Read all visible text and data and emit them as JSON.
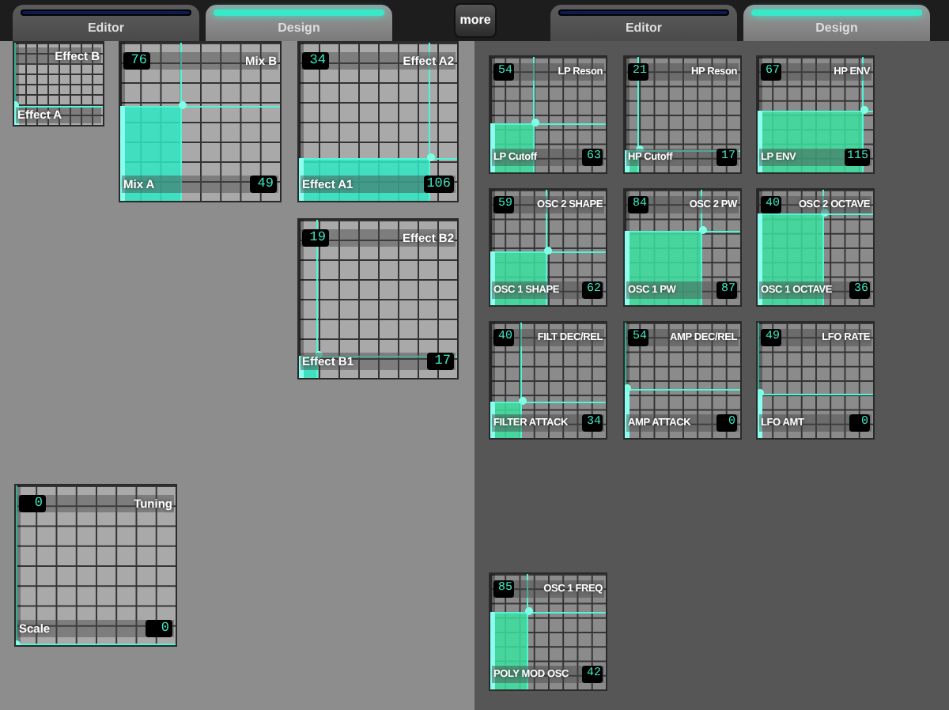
{
  "left_tabs": [
    {
      "label": "Editor",
      "selected": false
    },
    {
      "label": "Design",
      "selected": true
    }
  ],
  "more_button": "more",
  "right_tabs": [
    {
      "label": "Editor",
      "selected": false
    },
    {
      "label": "Design",
      "selected": true
    }
  ],
  "left_pads": [
    {
      "y": {
        "label": "Effect B",
        "level": 0.24
      },
      "x": {
        "label": "Effect A",
        "level": 0
      }
    },
    {
      "y": {
        "label": "Mix B",
        "value": "76",
        "level": 0.6
      },
      "x": {
        "label": "Mix A",
        "value": "49",
        "level": 0.39
      }
    },
    {
      "y": {
        "label": "Effect A2",
        "value": "34",
        "level": 0.27
      },
      "x": {
        "label": "Effect A1",
        "value": "106",
        "level": 0.83
      }
    },
    {
      "y": {
        "label": "Effect B2",
        "value": "19",
        "level": 0.14
      },
      "x": {
        "label": "Effect B1",
        "value": "17",
        "level": 0.12
      }
    },
    {
      "y": {
        "label": "Tuning",
        "value": "0",
        "level": 0
      },
      "x": {
        "label": "Scale",
        "value": "0",
        "level": 0
      }
    }
  ],
  "right_pads": [
    {
      "y": {
        "label": "LP Reson",
        "value": "54",
        "level": 0.43
      },
      "x": {
        "label": "LP Cutoff",
        "value": "63",
        "level": 0.39
      }
    },
    {
      "y": {
        "label": "HP Reson",
        "value": "21",
        "level": 0.19
      },
      "x": {
        "label": "HP Cutoff",
        "value": "17",
        "level": 0.13
      }
    },
    {
      "y": {
        "label": "HP ENV",
        "value": "67",
        "level": 0.53
      },
      "x": {
        "label": "LP ENV",
        "value": "115",
        "level": 0.92
      }
    },
    {
      "y": {
        "label": "OSC 2 SHAPE",
        "value": "59",
        "level": 0.47
      },
      "x": {
        "label": "OSC 1 SHAPE",
        "value": "62",
        "level": 0.49
      }
    },
    {
      "y": {
        "label": "OSC 2 PW",
        "value": "84",
        "level": 0.65
      },
      "x": {
        "label": "OSC 1 PW",
        "value": "87",
        "level": 0.67
      }
    },
    {
      "y": {
        "label": "OSC 2 OCTAVE",
        "value": "40",
        "level": 0.8
      },
      "x": {
        "label": "OSC 1 OCTAVE",
        "value": "36",
        "level": 0.58
      }
    },
    {
      "y": {
        "label": "FILT DEC/REL",
        "value": "40",
        "level": 0.32
      },
      "x": {
        "label": "FILTER ATTACK",
        "value": "34",
        "level": 0.28
      }
    },
    {
      "y": {
        "label": "AMP DEC/REL",
        "value": "54",
        "level": 0.43
      },
      "x": {
        "label": "AMP ATTACK",
        "value": "0",
        "level": 0.01
      }
    },
    {
      "y": {
        "label": "LFO RATE",
        "value": "49",
        "level": 0.39
      },
      "x": {
        "label": "LFO AMT",
        "value": "0",
        "level": 0.01
      }
    },
    {
      "y": {
        "label": "OSC 1 FREQ",
        "value": "85",
        "level": 0.67
      },
      "x": {
        "label": "POLY MOD OSC",
        "value": "42",
        "level": 0.33
      }
    }
  ]
}
